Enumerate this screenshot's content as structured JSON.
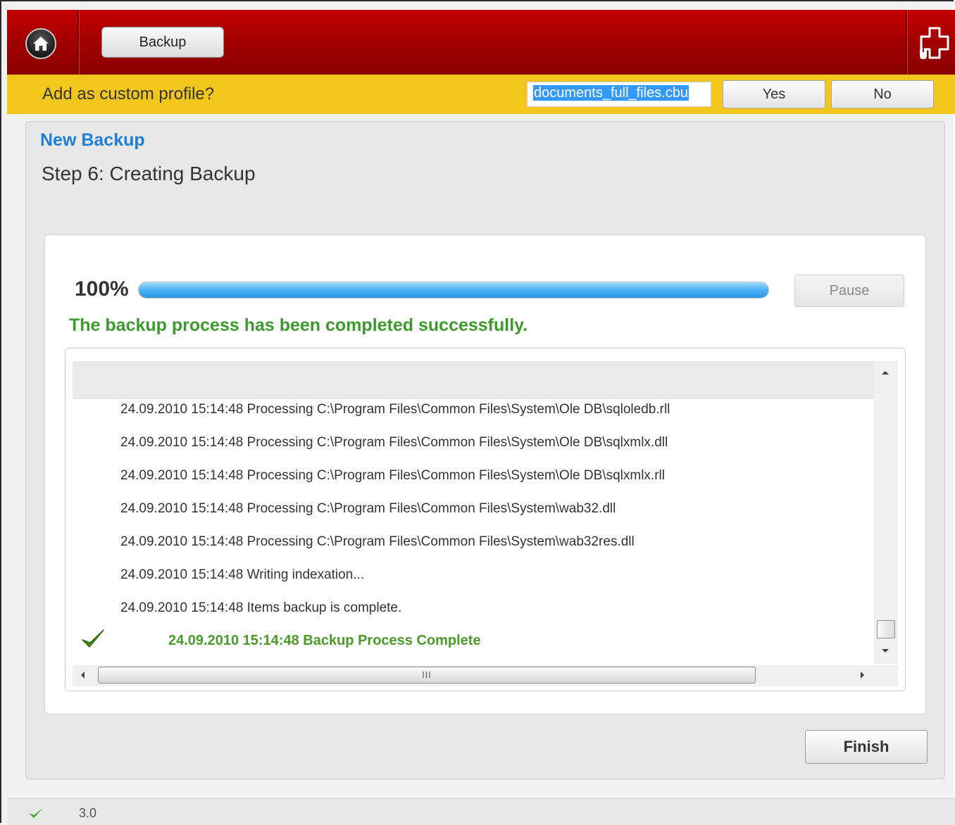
{
  "header": {
    "tab_label": "Backup",
    "icons": {
      "home": "home-icon",
      "plugin": "plugin-icon"
    }
  },
  "prompt": {
    "text": "Add as custom profile?",
    "profile_name": "documents_full_files.cbu",
    "yes_label": "Yes",
    "no_label": "No"
  },
  "panel": {
    "title": "New Backup",
    "step": "Step 6: Creating Backup",
    "progress_text": "100%",
    "progress_fraction": 1.0,
    "pause_label": "Pause",
    "success_message": "The backup process has been completed successfully.",
    "log_lines": [
      "24.09.2010 15:14:48 Processing C:\\Program Files\\Common Files\\System\\Ole DB\\sqloledb.rll",
      "24.09.2010 15:14:48 Processing C:\\Program Files\\Common Files\\System\\Ole DB\\sqlxmlx.dll",
      "24.09.2010 15:14:48 Processing C:\\Program Files\\Common Files\\System\\Ole DB\\sqlxmlx.rll",
      "24.09.2010 15:14:48 Processing C:\\Program Files\\Common Files\\System\\wab32.dll",
      "24.09.2010 15:14:48 Processing C:\\Program Files\\Common Files\\System\\wab32res.dll",
      "24.09.2010 15:14:48 Writing indexation...",
      "24.09.2010 15:14:48 Items backup is complete."
    ],
    "final_line": "24.09.2010 15:14:48 Backup Process Complete",
    "hscroll_grip": "III",
    "finish_label": "Finish"
  },
  "status": {
    "version": "3.0"
  },
  "colors": {
    "header_red": "#a10000",
    "prompt_yellow": "#f3c61b",
    "title_blue": "#1d7fdb",
    "success_green": "#3d9a2d",
    "progress_blue": "#2a95e8"
  }
}
